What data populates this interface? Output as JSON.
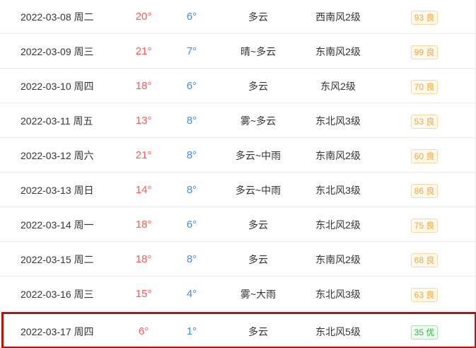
{
  "forecast": {
    "rows": [
      {
        "date": "2022-03-08 周二",
        "high": "20°",
        "low": "6°",
        "condition": "多云",
        "wind": "西南风2级",
        "aqi": "93 良",
        "aqi_level": "good"
      },
      {
        "date": "2022-03-09 周三",
        "high": "21°",
        "low": "7°",
        "condition": "晴~多云",
        "wind": "东南风2级",
        "aqi": "99 良",
        "aqi_level": "good"
      },
      {
        "date": "2022-03-10 周四",
        "high": "18°",
        "low": "6°",
        "condition": "多云",
        "wind": "东风2级",
        "aqi": "70 良",
        "aqi_level": "good"
      },
      {
        "date": "2022-03-11 周五",
        "high": "13°",
        "low": "8°",
        "condition": "雾~多云",
        "wind": "东北风3级",
        "aqi": "53 良",
        "aqi_level": "good"
      },
      {
        "date": "2022-03-12 周六",
        "high": "21°",
        "low": "8°",
        "condition": "多云~中雨",
        "wind": "东南风2级",
        "aqi": "60 良",
        "aqi_level": "good"
      },
      {
        "date": "2022-03-13 周日",
        "high": "14°",
        "low": "8°",
        "condition": "多云~中雨",
        "wind": "东北风3级",
        "aqi": "86 良",
        "aqi_level": "good"
      },
      {
        "date": "2022-03-14 周一",
        "high": "18°",
        "low": "6°",
        "condition": "多云",
        "wind": "东北风2级",
        "aqi": "75 良",
        "aqi_level": "good"
      },
      {
        "date": "2022-03-15 周二",
        "high": "18°",
        "low": "8°",
        "condition": "多云",
        "wind": "东南风2级",
        "aqi": "68 良",
        "aqi_level": "good"
      },
      {
        "date": "2022-03-16 周三",
        "high": "15°",
        "low": "4°",
        "condition": "雾~大雨",
        "wind": "东北风3级",
        "aqi": "63 良",
        "aqi_level": "good"
      },
      {
        "date": "2022-03-17 周四",
        "high": "6°",
        "low": "1°",
        "condition": "多云",
        "wind": "东北风5级",
        "aqi": "35 优",
        "aqi_level": "excellent"
      }
    ]
  },
  "colors": {
    "high_temp": "#ff5a5a",
    "low_temp": "#3d8fe8",
    "aqi_good": "#f2a637",
    "aqi_excellent": "#33b24b",
    "highlight_border": "#b8140c"
  }
}
